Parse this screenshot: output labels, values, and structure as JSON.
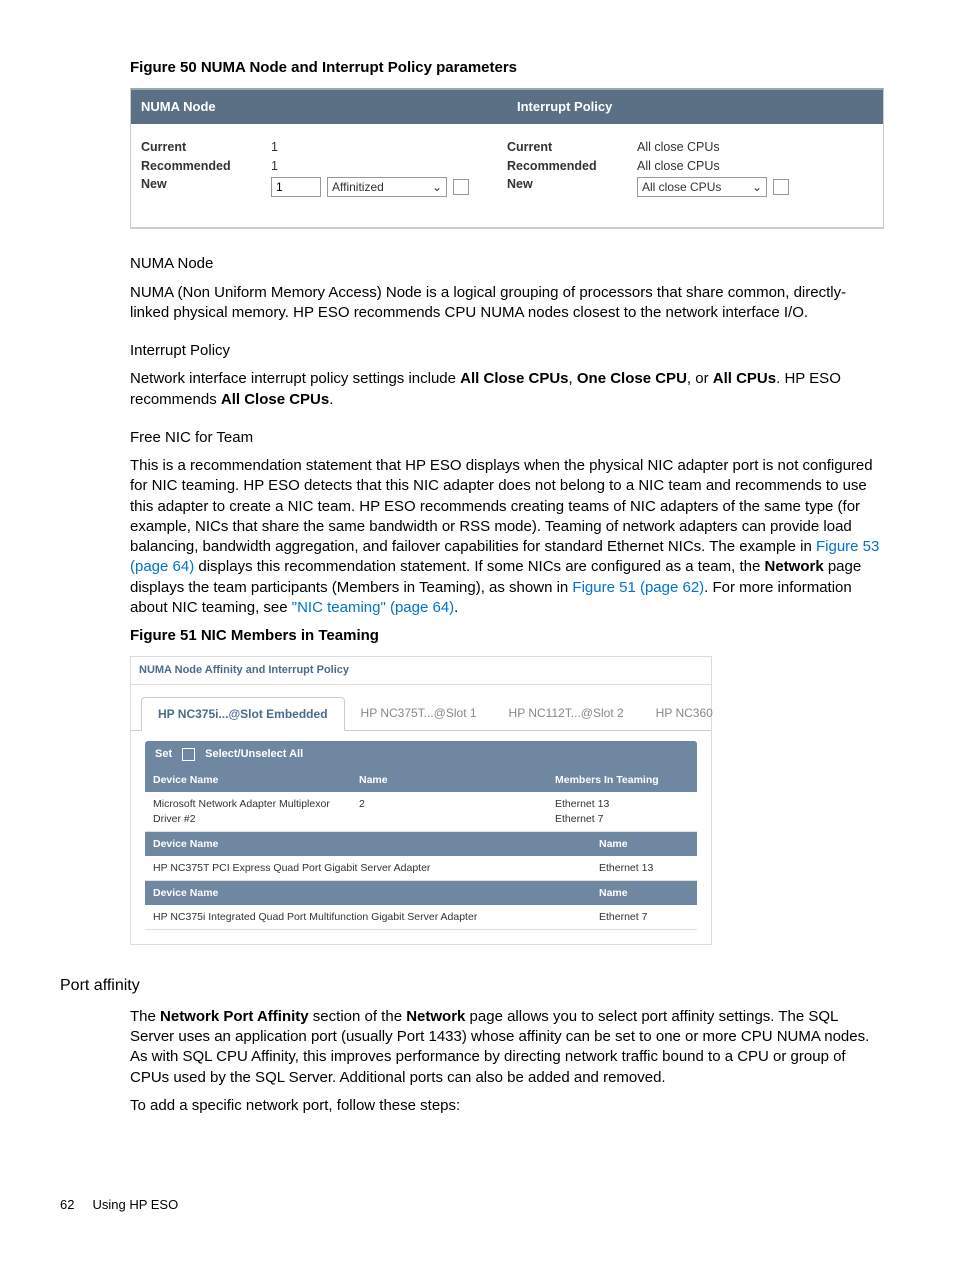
{
  "figure50": {
    "caption": "Figure 50 NUMA Node and Interrupt Policy parameters",
    "left": {
      "header": "NUMA Node",
      "current_label": "Current",
      "current_value": "1",
      "recommended_label": "Recommended",
      "recommended_value": "1",
      "new_label": "New",
      "new_input_value": "1",
      "new_select": "Affinitized"
    },
    "right": {
      "header": "Interrupt Policy",
      "current_label": "Current",
      "current_value": "All close CPUs",
      "recommended_label": "Recommended",
      "recommended_value": "All close CPUs",
      "new_label": "New",
      "new_select": "All close CPUs"
    }
  },
  "numa": {
    "title": "NUMA Node",
    "body": "NUMA (Non Uniform Memory Access) Node is a logical grouping of processors that share common, directly-linked physical memory. HP ESO recommends CPU NUMA nodes closest to the network interface I/O."
  },
  "interrupt": {
    "title": "Interrupt Policy",
    "body_pre": "Network interface interrupt policy settings include ",
    "b1": "All Close CPUs",
    "sep1": ", ",
    "b2": "One Close CPU",
    "sep2": ", or ",
    "b3": "All CPUs",
    "body_post": ". HP ESO recommends ",
    "b4": "All Close CPUs",
    "end": "."
  },
  "freenic": {
    "title": "Free NIC for Team",
    "p_pre": "This is a recommendation statement that HP ESO displays when the physical NIC adapter port is not configured for NIC teaming. HP ESO detects that this NIC adapter does not belong to a NIC team and recommends to use this adapter to create a NIC team. HP ESO recommends creating teams of NIC adapters of the same type (for example, NICs that share the same bandwidth or RSS mode). Teaming of network adapters can provide load balancing, bandwidth aggregation, and failover capabilities for standard Ethernet NICs. The example in ",
    "link1": "Figure 53 (page 64)",
    "p_mid1": " displays this recommendation statement. If some NICs are configured as a team, the ",
    "b_network": "Network",
    "p_mid2": " page displays the team participants (Members in Teaming), as shown in ",
    "link2": "Figure 51 (page 62)",
    "p_mid3": ". For more information about NIC teaming, see ",
    "link3": "\"NIC teaming\" (page 64)",
    "p_end": "."
  },
  "figure51": {
    "caption": "Figure 51 NIC Members in Teaming",
    "title": "NUMA Node Affinity and Interrupt Policy",
    "tabs": [
      "HP NC375i...@Slot Embedded",
      "HP NC375T...@Slot 1",
      "HP NC112T...@Slot 2",
      "HP NC360"
    ],
    "toolbar": {
      "set": "Set",
      "select_all": "Select/Unselect All"
    },
    "headers1": {
      "devname": "Device Name",
      "name": "Name",
      "members": "Members In Teaming"
    },
    "row1": {
      "dev": "Microsoft Network Adapter Multiplexor Driver #2",
      "name": "2",
      "members": "Ethernet 13\nEthernet 7"
    },
    "headers2": {
      "devname": "Device Name",
      "name": "Name"
    },
    "row2": {
      "dev": "HP NC375T PCI Express Quad Port Gigabit Server Adapter",
      "name": "Ethernet 13"
    },
    "headers3": {
      "devname": "Device Name",
      "name": "Name"
    },
    "row3": {
      "dev": "HP NC375i Integrated Quad Port Multifunction Gigabit Server Adapter",
      "name": "Ethernet 7"
    }
  },
  "port_affinity": {
    "title": "Port affinity",
    "p1_pre": "The ",
    "b1": "Network Port Affinity",
    "p1_mid1": " section of the ",
    "b2": "Network",
    "p1_post": " page allows you to select port affinity settings. The SQL Server uses an application port (usually Port 1433) whose affinity can be set to one or more CPU NUMA nodes. As with SQL CPU Affinity, this improves performance by directing network traffic bound to a CPU or group of CPUs used by the SQL Server. Additional ports can also be added and removed.",
    "p2": "To add a specific network port, follow these steps:"
  },
  "footer": {
    "page": "62",
    "label": "Using HP ESO"
  }
}
